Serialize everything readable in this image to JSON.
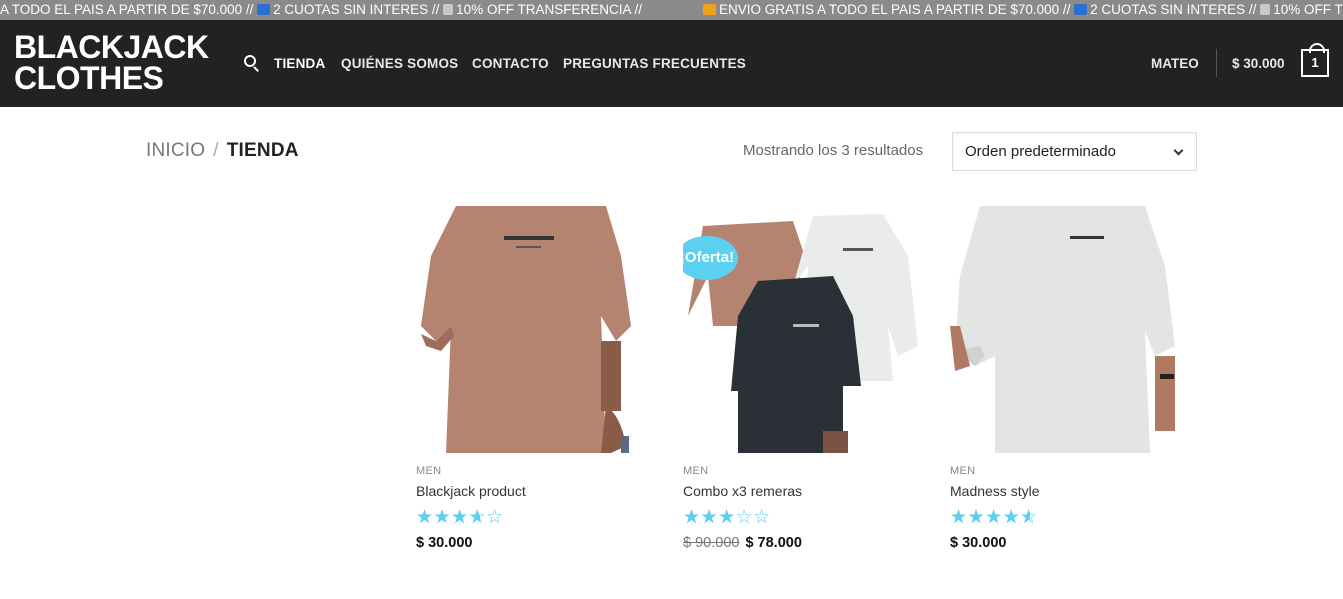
{
  "announcement": {
    "segment1": "A TODO EL PAIS A PARTIR DE $70.000 // ",
    "segment1_cuotas": "2 CUOTAS SIN INTERES // ",
    "segment1_transfer": "10% OFF TRANSFERENCIA //",
    "segment2_envio": "ENVIO GRATIS A TODO EL PAIS A PARTIR DE $70.000 // ",
    "segment2_cuotas": "2 CUOTAS SIN INTERES // ",
    "segment2_transfer": "10% OFF TRANSF"
  },
  "brand": {
    "line1": "BLACKJACK",
    "line2": "CLOTHES"
  },
  "nav": {
    "items": [
      "TIENDA",
      "QUIÉNES SOMOS",
      "CONTACTO",
      "PREGUNTAS FRECUENTES"
    ],
    "active": "TIENDA"
  },
  "account": {
    "user": "MATEO",
    "cart_total": "$ 30.000",
    "cart_count": "1"
  },
  "breadcrumb": {
    "home": "INICIO",
    "separator": "/",
    "current": "TIENDA"
  },
  "results_text": "Mostrando los 3 resultados",
  "sort": {
    "selected": "Orden predeterminado"
  },
  "products": [
    {
      "category": "MEN",
      "name": "Blackjack product",
      "rating": 4,
      "price": "$ 30.000",
      "old_price": "",
      "badge": ""
    },
    {
      "category": "MEN",
      "name": "Combo x3 remeras",
      "rating": 3.5,
      "price": "$ 78.000",
      "old_price": "$ 90.000",
      "badge": "¡Oferta!"
    },
    {
      "category": "MEN",
      "name": "Madness style",
      "rating": 5,
      "price": "$ 30.000",
      "old_price": "",
      "badge": ""
    }
  ],
  "colors": {
    "header_bg": "#222222",
    "topbar_bg": "#8a8a8a",
    "accent": "#5bd0f0",
    "shirt_pink": "#b58471",
    "shirt_white": "#e9ecea",
    "shirt_black": "#2b2f36"
  }
}
